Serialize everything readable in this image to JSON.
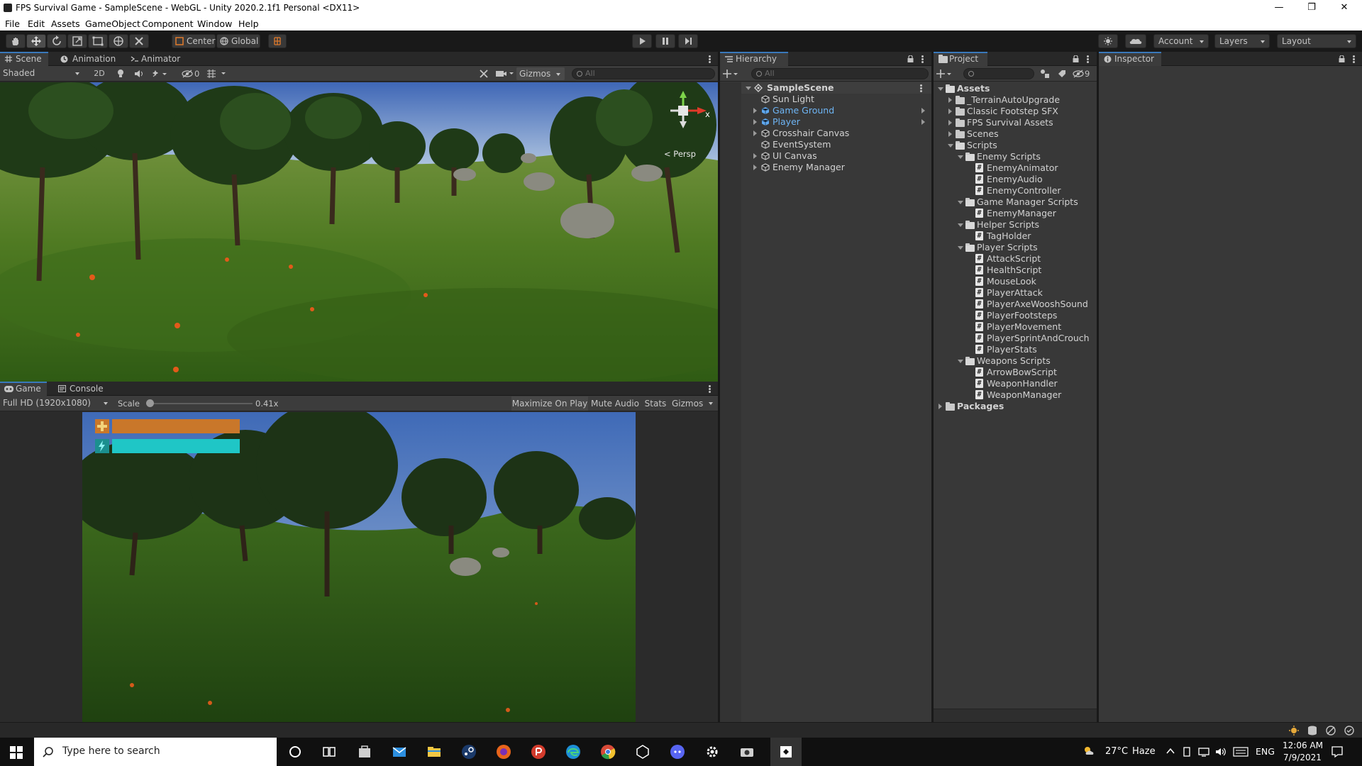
{
  "window": {
    "title": "FPS Survival Game - SampleScene - WebGL - Unity 2020.2.1f1 Personal <DX11>",
    "controls": {
      "minimize": "—",
      "restore": "❐",
      "close": "✕"
    }
  },
  "menu": [
    "File",
    "Edit",
    "Assets",
    "GameObject",
    "Component",
    "Window",
    "Help"
  ],
  "toolbar": {
    "pivot_label": "Center",
    "space_label": "Global",
    "account_label": "Account",
    "layers_label": "Layers",
    "layout_label": "Layout"
  },
  "scene_panel": {
    "tabs": [
      "Scene",
      "Animation",
      "Animator"
    ],
    "shading_mode": "Shaded",
    "mode_2d_label": "2D",
    "hidden_count": "0",
    "gizmos_label": "Gizmos",
    "search_placeholder": "All",
    "persp_label": "< Persp",
    "axis_x_label": "x"
  },
  "game_panel": {
    "tabs": [
      "Game",
      "Console"
    ],
    "resolution_label": "Full HD (1920x1080)",
    "scale_label": "Scale",
    "scale_value": "0.41x",
    "scale_fraction": 0.0,
    "maximize_label": "Maximize On Play",
    "mute_label": "Mute Audio",
    "stats_label": "Stats",
    "gizmos_label": "Gizmos",
    "hud": {
      "health_fraction": 1.0,
      "stamina_fraction": 1.0,
      "health_color": "#c9772a",
      "stamina_color": "#1fc6c6"
    }
  },
  "hierarchy": {
    "title": "Hierarchy",
    "search_placeholder": "All",
    "scene_name": "SampleScene",
    "items": [
      {
        "name": "Sun Light",
        "expandable": false,
        "highlight": false
      },
      {
        "name": "Game Ground",
        "expandable": true,
        "highlight": true
      },
      {
        "name": "Player",
        "expandable": true,
        "highlight": true
      },
      {
        "name": "Crosshair Canvas",
        "expandable": true,
        "highlight": false
      },
      {
        "name": "EventSystem",
        "expandable": false,
        "highlight": false
      },
      {
        "name": "UI Canvas",
        "expandable": true,
        "highlight": false
      },
      {
        "name": "Enemy Manager",
        "expandable": true,
        "highlight": false
      }
    ]
  },
  "project": {
    "title": "Project",
    "hidden_count": "9",
    "tree": [
      {
        "label": "Assets",
        "depth": 0,
        "kind": "folder",
        "open": true,
        "bold": true
      },
      {
        "label": "_TerrainAutoUpgrade",
        "depth": 1,
        "kind": "folder",
        "open": false
      },
      {
        "label": "Classic Footstep SFX",
        "depth": 1,
        "kind": "folder",
        "open": false
      },
      {
        "label": "FPS Survival Assets",
        "depth": 1,
        "kind": "folder",
        "open": false
      },
      {
        "label": "Scenes",
        "depth": 1,
        "kind": "folder",
        "open": false
      },
      {
        "label": "Scripts",
        "depth": 1,
        "kind": "folder",
        "open": true
      },
      {
        "label": "Enemy Scripts",
        "depth": 2,
        "kind": "folder",
        "open": true
      },
      {
        "label": "EnemyAnimator",
        "depth": 3,
        "kind": "script"
      },
      {
        "label": "EnemyAudio",
        "depth": 3,
        "kind": "script"
      },
      {
        "label": "EnemyController",
        "depth": 3,
        "kind": "script"
      },
      {
        "label": "Game Manager Scripts",
        "depth": 2,
        "kind": "folder",
        "open": true
      },
      {
        "label": "EnemyManager",
        "depth": 3,
        "kind": "script"
      },
      {
        "label": "Helper Scripts",
        "depth": 2,
        "kind": "folder",
        "open": true
      },
      {
        "label": "TagHolder",
        "depth": 3,
        "kind": "script"
      },
      {
        "label": "Player Scripts",
        "depth": 2,
        "kind": "folder",
        "open": true
      },
      {
        "label": "AttackScript",
        "depth": 3,
        "kind": "script"
      },
      {
        "label": "HealthScript",
        "depth": 3,
        "kind": "script"
      },
      {
        "label": "MouseLook",
        "depth": 3,
        "kind": "script"
      },
      {
        "label": "PlayerAttack",
        "depth": 3,
        "kind": "script"
      },
      {
        "label": "PlayerAxeWooshSound",
        "depth": 3,
        "kind": "script"
      },
      {
        "label": "PlayerFootsteps",
        "depth": 3,
        "kind": "script"
      },
      {
        "label": "PlayerMovement",
        "depth": 3,
        "kind": "script"
      },
      {
        "label": "PlayerSprintAndCrouch",
        "depth": 3,
        "kind": "script"
      },
      {
        "label": "PlayerStats",
        "depth": 3,
        "kind": "script"
      },
      {
        "label": "Weapons Scripts",
        "depth": 2,
        "kind": "folder",
        "open": true
      },
      {
        "label": "ArrowBowScript",
        "depth": 3,
        "kind": "script"
      },
      {
        "label": "WeaponHandler",
        "depth": 3,
        "kind": "script"
      },
      {
        "label": "WeaponManager",
        "depth": 3,
        "kind": "script"
      },
      {
        "label": "Packages",
        "depth": 0,
        "kind": "folder",
        "open": false,
        "bold": true
      }
    ]
  },
  "inspector": {
    "title": "Inspector"
  },
  "taskbar": {
    "search_placeholder": "Type here to search",
    "weather_temp": "27°C",
    "weather_desc": "Haze",
    "language": "ENG",
    "time": "12:06 AM",
    "date": "7/9/2021"
  }
}
